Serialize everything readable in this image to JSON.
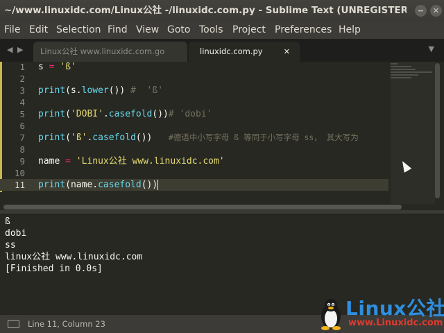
{
  "window": {
    "title": "~/www.linuxidc.com/Linux公社 -/linuxidc.com.py - Sublime Text (UNREGISTERED)",
    "min_glyph": "−",
    "close_glyph": "✕"
  },
  "menu": {
    "file": "File",
    "edit": "Edit",
    "selection": "Selection",
    "find": "Find",
    "view": "View",
    "goto": "Goto",
    "tools": "Tools",
    "project": "Project",
    "preferences": "Preferences",
    "help": "Help"
  },
  "tabs": {
    "nav_back": "◀",
    "nav_forward": "▶",
    "inactive_label": "Linux公社 www.linuxidc.com.go",
    "active_label": "linuxidc.com.py",
    "close_glyph": "✕",
    "dropdown_glyph": "▼"
  },
  "editor": {
    "line_numbers": [
      "1",
      "2",
      "3",
      "4",
      "5",
      "6",
      "7",
      "8",
      "9",
      "10",
      "11"
    ],
    "current_line": 11,
    "tokens": {
      "l1_a": "s ",
      "l1_op": "=",
      "l1_str": " 'ß'",
      "l3_fn": "print",
      "l3_a": "(s.",
      "l3_fn2": "lower",
      "l3_b": "()) ",
      "l3_cm": "#  'ß'",
      "l5_fn": "print",
      "l5_a": "(",
      "l5_str": "'DOBI'",
      "l5_b": ".",
      "l5_fn2": "casefold",
      "l5_c": "())",
      "l5_cm": "# 'dobi'",
      "l7_fn": "print",
      "l7_a": "(",
      "l7_str": "'ß'",
      "l7_b": ".",
      "l7_fn2": "casefold",
      "l7_c": "())   ",
      "l7_cm": "#德语中小写字母 ß 等同于小写字母 ss， 其大写为",
      "l9_a": "name ",
      "l9_op": "=",
      "l9_str": " 'Linux公社 www.linuxidc.com'",
      "l11_fn": "print",
      "l11_a": "(name.",
      "l11_fn2": "casefold",
      "l11_b": "())"
    }
  },
  "output": {
    "lines": [
      "ß",
      "dobi",
      "ss",
      "linux公社 www.linuxidc.com",
      "[Finished in 0.0s]"
    ]
  },
  "status": {
    "position": "Line 11, Column 23"
  },
  "watermark": {
    "brand": "Linux公社",
    "url": "www.Linuxidc.com"
  },
  "colors": {
    "editor_bg": "#272822",
    "keyword": "#f92672",
    "function": "#66d9ef",
    "string": "#e6db74",
    "comment": "#75715e",
    "watermark_blue": "#2e8fe0",
    "watermark_red": "#e03a2e"
  }
}
